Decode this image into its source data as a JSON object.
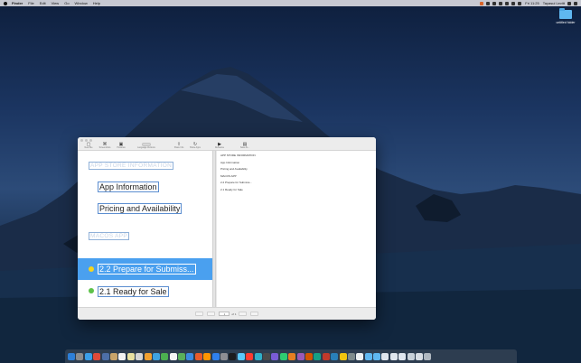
{
  "menubar": {
    "app_name": "Finder",
    "items": [
      "File",
      "Edit",
      "View",
      "Go",
      "Window",
      "Help"
    ],
    "clock": "Fri 11:25",
    "user": "Tayasui Levitt"
  },
  "desktop": {
    "folder_label": "untitled folder"
  },
  "toolbar": {
    "tools": [
      {
        "label": "New File",
        "icon": "new-file-icon",
        "glyph": "▢"
      },
      {
        "label": "Screenshots",
        "icon": "screenshot-icon",
        "glyph": "⌘"
      },
      {
        "label": "Previews",
        "icon": "preview-icon",
        "glyph": "▣"
      },
      {
        "label": "Language Versions",
        "icon": "language-toggle-icon",
        "glyph": ""
      },
      {
        "label": "Share Info",
        "icon": "share-info-icon",
        "glyph": "⇧"
      },
      {
        "label": "Share Apps",
        "icon": "share-apps-icon",
        "glyph": "↻"
      },
      {
        "label": "Rehearse",
        "icon": "play-icon",
        "glyph": "▶"
      },
      {
        "label": "Save As...",
        "icon": "save-icon",
        "glyph": "▤"
      }
    ]
  },
  "outline": {
    "section_app_store": "APP STORE INFORMATION",
    "item_app_information": "App Information",
    "item_pricing": "Pricing and Availability",
    "section_macos": "MACOS APP",
    "item_prepare": "2.2 Prepare for Submiss...",
    "item_ready": "2.1 Ready for Sale",
    "prepare_status_color": "#f5d51e",
    "ready_status_color": "#5ec24a",
    "selection_color": "#4aa0ef"
  },
  "preview_lines": [
    "APP STORE INFORMATION",
    "App Information",
    "Pricing and Availability",
    "MACOS APP",
    "2.2 Prepare for Submiss...",
    "2.1 Ready for Sale"
  ],
  "bottombar": {
    "page_value": "1",
    "page_total": "of 1"
  }
}
